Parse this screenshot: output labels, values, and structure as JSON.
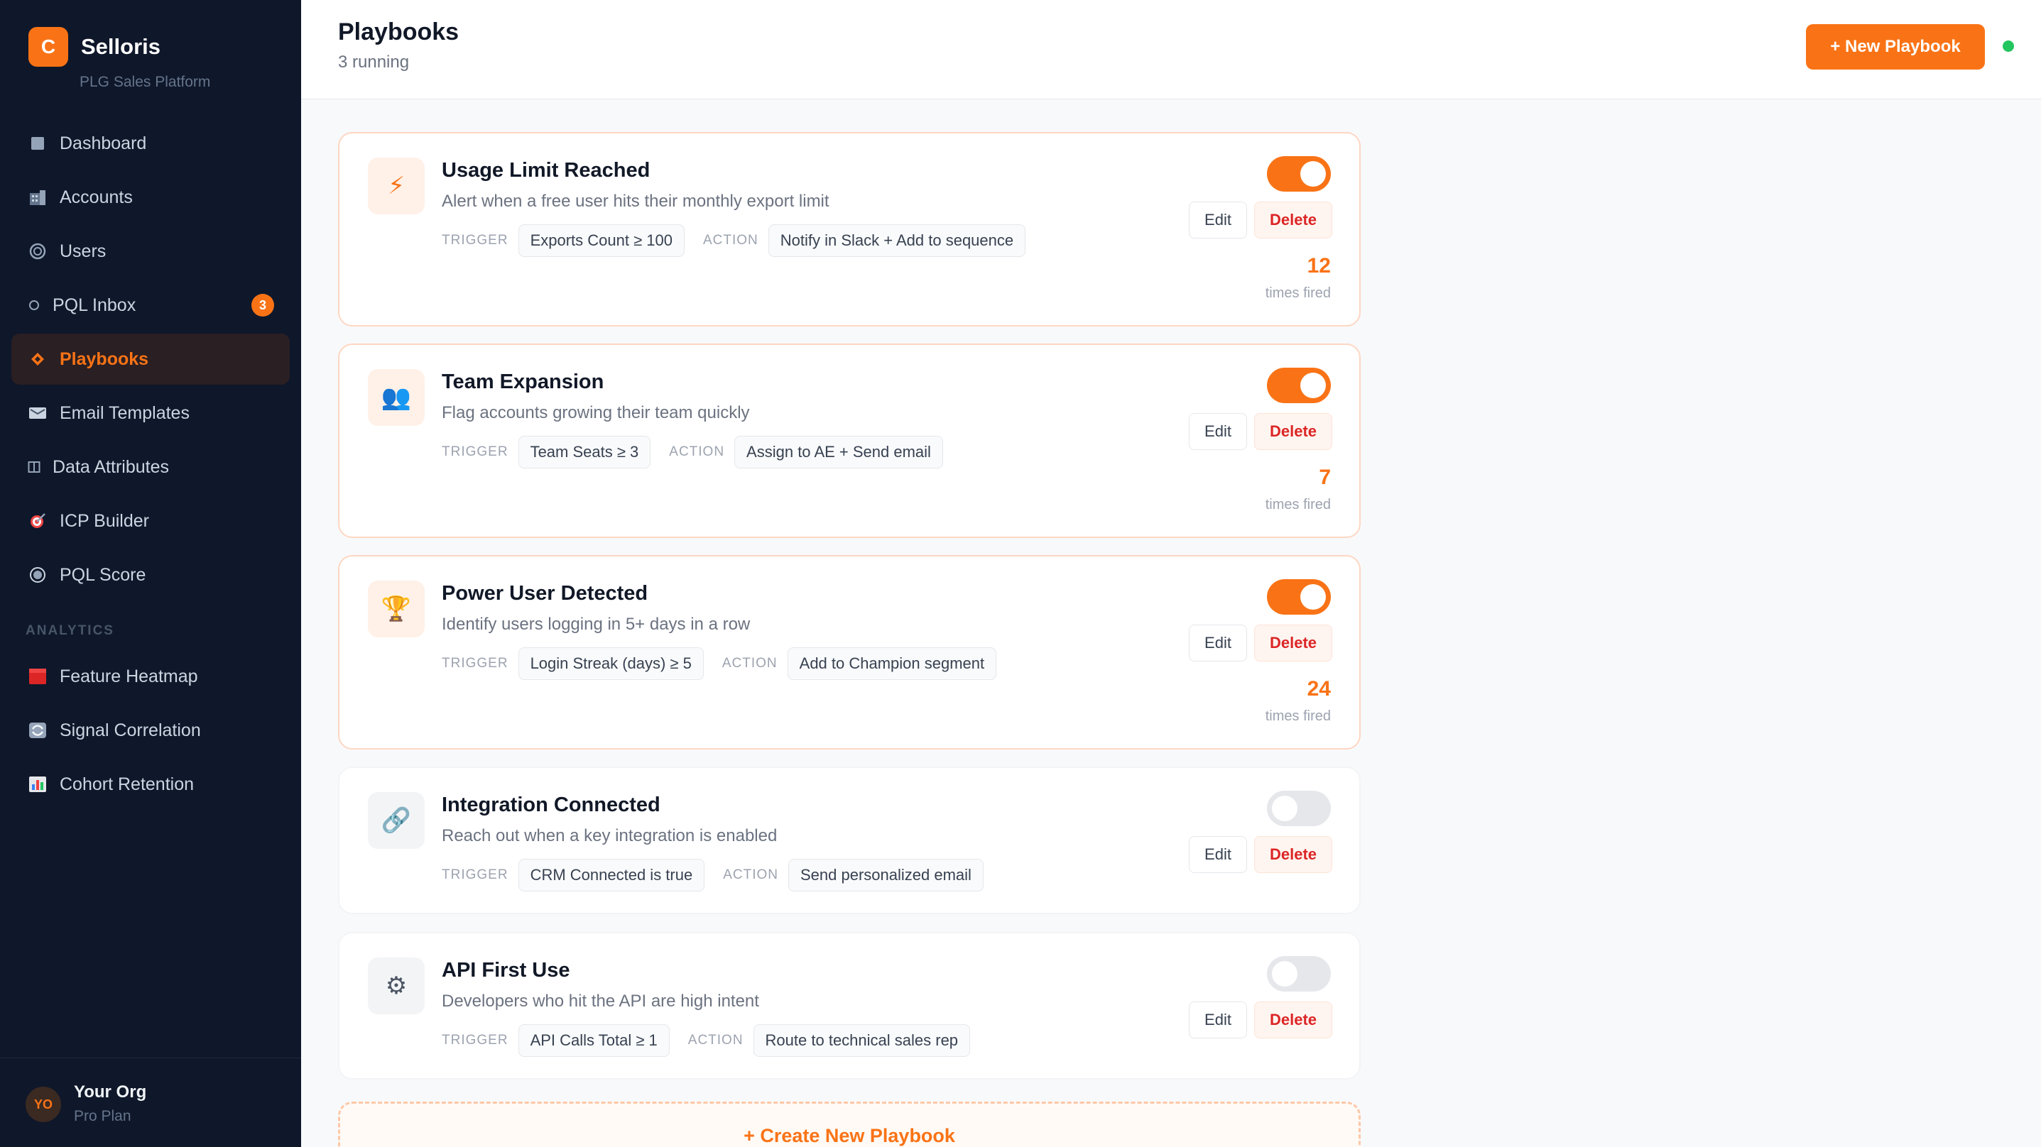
{
  "brand": {
    "logo_letter": "C",
    "name": "Selloris",
    "subtitle": "PLG Sales Platform"
  },
  "sidebar": {
    "items": [
      {
        "label": "Dashboard",
        "icon": "grid-icon"
      },
      {
        "label": "Accounts",
        "icon": "building-icon"
      },
      {
        "label": "Users",
        "icon": "users-icon"
      },
      {
        "label": "PQL Inbox",
        "icon": "inbox-icon",
        "badge": "3"
      },
      {
        "label": "Playbooks",
        "icon": "diamond-icon",
        "active": true
      },
      {
        "label": "Email Templates",
        "icon": "mail-icon"
      },
      {
        "label": "Data Attributes",
        "icon": "columns-icon"
      },
      {
        "label": "ICP Builder",
        "icon": "target-icon"
      },
      {
        "label": "PQL Score",
        "icon": "score-icon"
      }
    ],
    "section_label": "ANALYTICS",
    "analytics_items": [
      {
        "label": "Feature Heatmap",
        "icon": "heatmap-icon"
      },
      {
        "label": "Signal Correlation",
        "icon": "correlation-icon"
      },
      {
        "label": "Cohort Retention",
        "icon": "bar-chart-icon"
      }
    ],
    "footer": {
      "avatar_initials": "YO",
      "org_name": "Your Org",
      "plan": "Pro Plan"
    }
  },
  "header": {
    "title": "Playbooks",
    "subtitle": "3 running",
    "new_button": "+ New Playbook"
  },
  "labels": {
    "trigger": "TRIGGER",
    "action": "ACTION",
    "edit": "Edit",
    "delete": "Delete",
    "times_fired": "times fired"
  },
  "playbooks": [
    {
      "title": "Usage Limit Reached",
      "description": "Alert when a free user hits their monthly export limit",
      "trigger": "Exports Count ≥ 100",
      "action": "Notify in Slack + Add to sequence",
      "enabled": true,
      "fired": "12",
      "icon": "lightning-icon",
      "glyph": "⚡"
    },
    {
      "title": "Team Expansion",
      "description": "Flag accounts growing their team quickly",
      "trigger": "Team Seats ≥ 3",
      "action": "Assign to AE + Send email",
      "enabled": true,
      "fired": "7",
      "icon": "people-icon",
      "glyph": "👥"
    },
    {
      "title": "Power User Detected",
      "description": "Identify users logging in 5+ days in a row",
      "trigger": "Login Streak (days) ≥ 5",
      "action": "Add to Champion segment",
      "enabled": true,
      "fired": "24",
      "icon": "trophy-icon",
      "glyph": "🏆"
    },
    {
      "title": "Integration Connected",
      "description": "Reach out when a key integration is enabled",
      "trigger": "CRM Connected is true",
      "action": "Send personalized email",
      "enabled": false,
      "icon": "link-icon",
      "glyph": "🔗"
    },
    {
      "title": "API First Use",
      "description": "Developers who hit the API are high intent",
      "trigger": "API Calls Total ≥ 1",
      "action": "Route to technical sales rep",
      "enabled": false,
      "icon": "gear-icon",
      "glyph": "⚙"
    }
  ],
  "create_button": "+ Create New Playbook",
  "colors": {
    "accent": "#f97316",
    "sidebar_bg": "#0f172a",
    "status_online": "#22c55e",
    "danger": "#dc2626"
  }
}
